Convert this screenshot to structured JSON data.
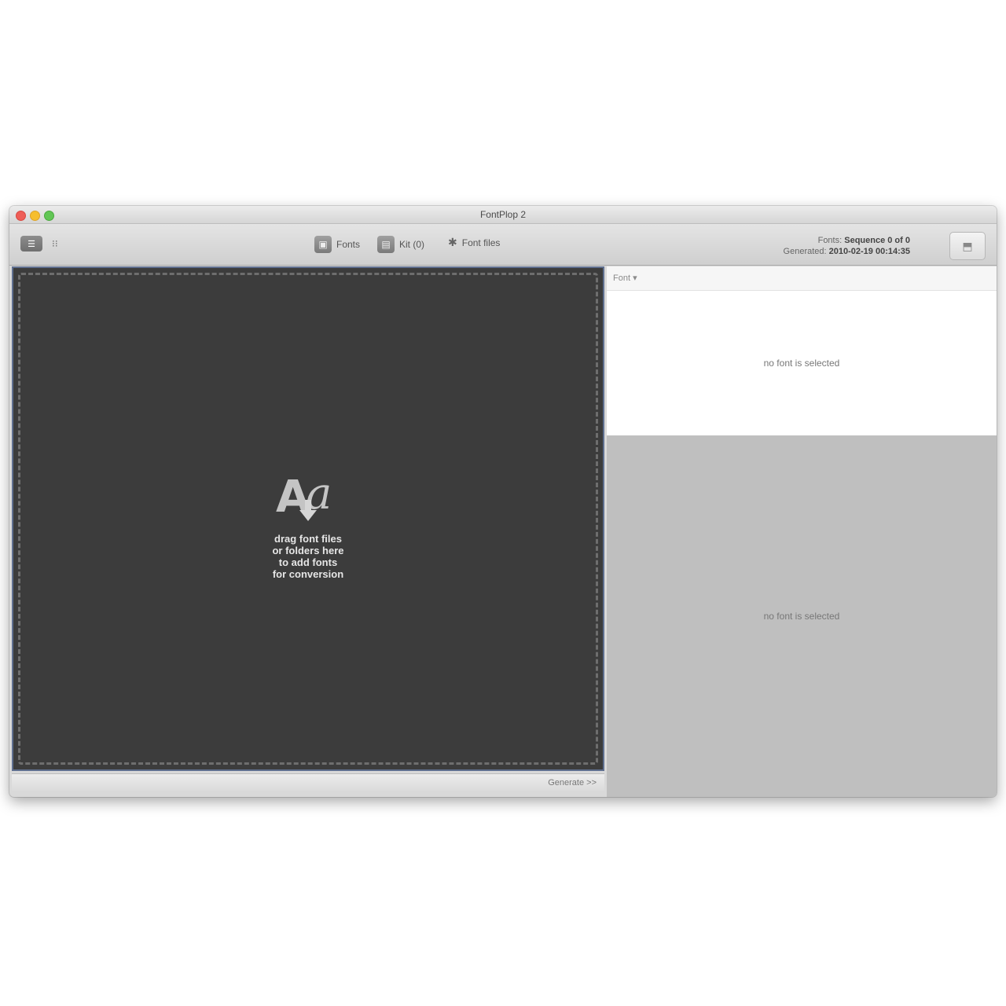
{
  "window": {
    "title": "FontPlop 2"
  },
  "toolbar": {
    "view_label": "",
    "fonts_label": "Fonts",
    "kits_label": "Kit (0)",
    "fontfiles_label": "Font files",
    "info": {
      "line1_label": "Fonts:",
      "line1_value": "Sequence 0 of 0",
      "line2_label": "Generated:",
      "line2_value": "2010-02-19 00:14:35"
    }
  },
  "dropzone": {
    "logo_big": "A",
    "logo_small": "a",
    "lines": [
      "drag font files",
      "or folders here",
      "to add fonts",
      "for conversion"
    ]
  },
  "status": {
    "text": "Generate >>"
  },
  "right": {
    "header_label": "Font ▾",
    "top_message": "no font is selected",
    "bottom_message": "no font is selected"
  }
}
